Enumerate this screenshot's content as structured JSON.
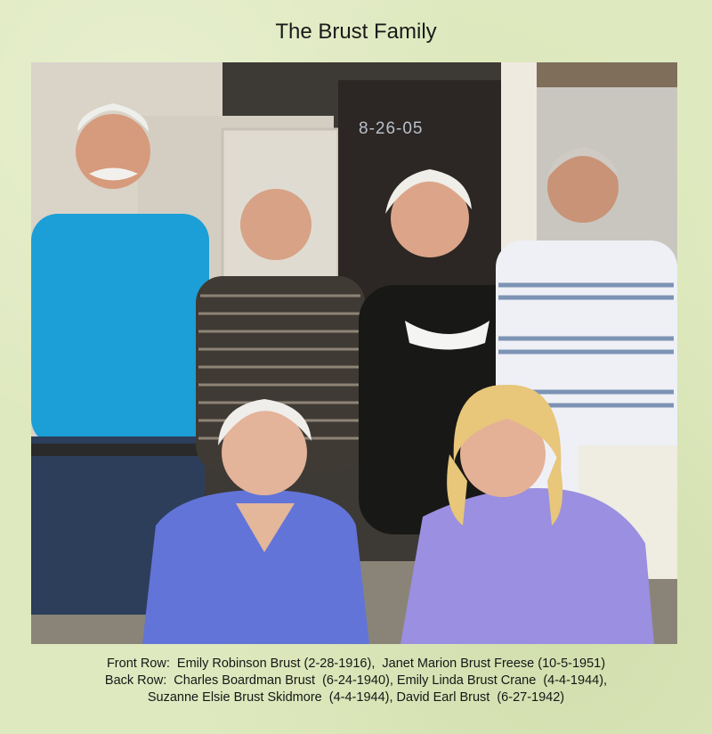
{
  "title": "The Brust Family",
  "photo": {
    "date_stamp": "8-26-05"
  },
  "caption": {
    "line1": "Front Row:  Emily Robinson Brust (2-28-1916),  Janet Marion Brust Freese (10-5-1951)",
    "line2": "Back Row:  Charles Boardman Brust  (6-24-1940), Emily Linda Brust Crane  (4-4-1944),",
    "line3": "Suzanne Elsie Brust Skidmore  (4-4-1944), David Earl Brust  (6-27-1942)"
  }
}
